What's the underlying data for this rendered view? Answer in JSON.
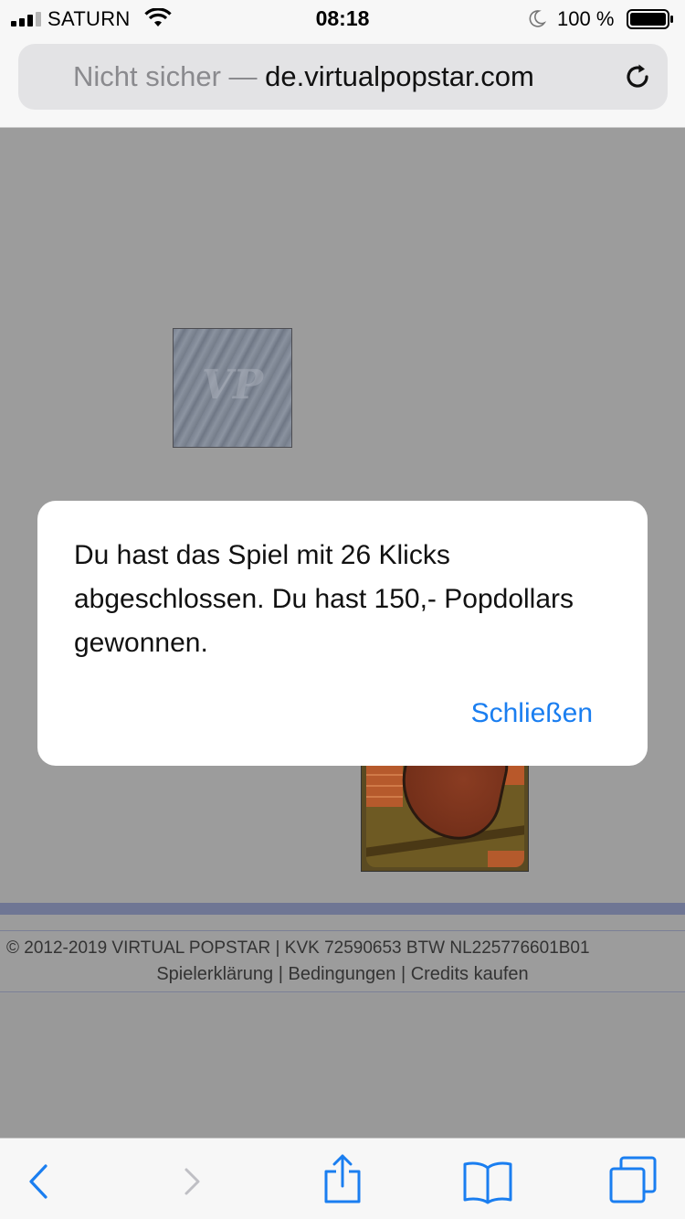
{
  "status_bar": {
    "carrier": "SATURN",
    "time": "08:18",
    "battery_percent": "100 %",
    "icons": [
      "signal-icon",
      "wifi-icon",
      "moon-icon",
      "battery-icon"
    ]
  },
  "address_bar": {
    "security_label": "Nicht sicher —",
    "domain": "de.virtualpopstar.com",
    "reload_icon": "reload-icon"
  },
  "game": {
    "card_back_logo": "VP"
  },
  "footer": {
    "copyright": "© 2012-2019 VIRTUAL POPSTAR | KVK 72590653 BTW NL225776601B01",
    "links": [
      "Spielerklärung",
      "Bedingungen",
      "Credits kaufen"
    ],
    "separator": " | "
  },
  "dialog": {
    "message": "Du hast das Spiel mit  26 Klicks abgeschlossen. Du hast  150,- Popdollars gewonnen.",
    "close_label": "Schließen"
  },
  "toolbar": {
    "items": [
      "back-icon",
      "forward-icon",
      "share-icon",
      "bookmarks-icon",
      "tabs-icon"
    ]
  },
  "colors": {
    "accent": "#1a7ef0",
    "footer_bar": "#6f7694",
    "page_bg": "#9c9c9c"
  }
}
